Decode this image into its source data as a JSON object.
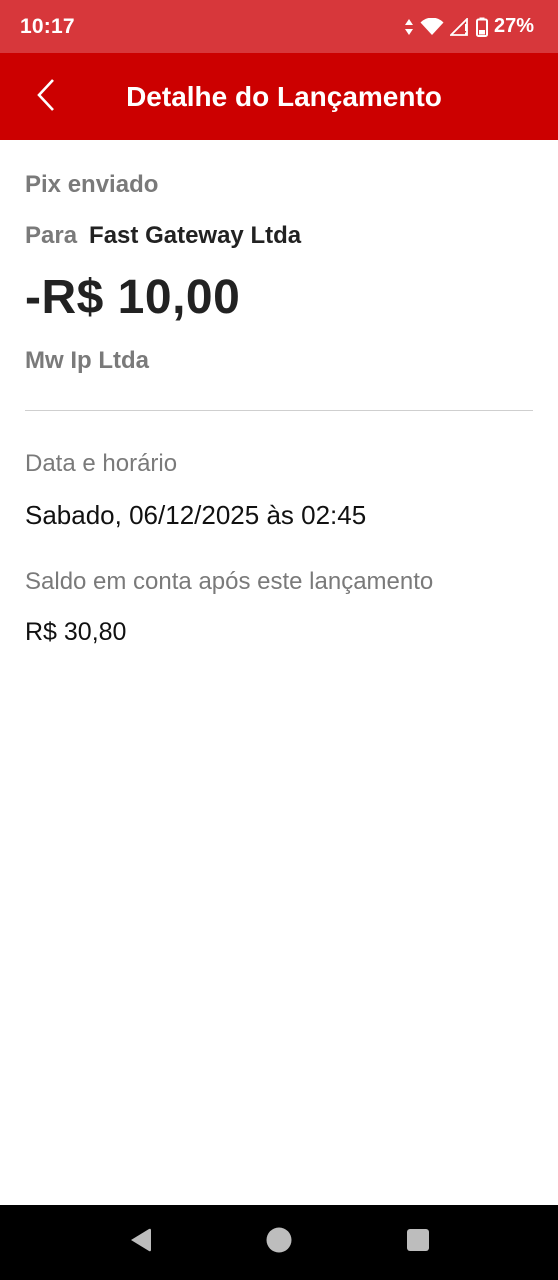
{
  "status_bar": {
    "time": "10:17",
    "battery_percent": "27%",
    "icons": [
      "data-arrows-icon",
      "wifi-icon",
      "signal-icon",
      "battery-icon"
    ]
  },
  "app_bar": {
    "title": "Detalhe do Lançamento",
    "back_icon": "chevron-left-icon",
    "background_color": "#cc0000"
  },
  "transaction": {
    "type": "Pix enviado",
    "recipient_prefix": "Para",
    "recipient_name": "Fast Gateway Ltda",
    "amount": "-R$ 10,00",
    "institution": "Mw Ip Ltda"
  },
  "details": {
    "date_label": "Data e horário",
    "date_value": "Sabado, 06/12/2025 às 02:45",
    "balance_label": "Saldo em conta após este lançamento",
    "balance_value": "R$ 30,80"
  },
  "nav_bar": {
    "buttons": [
      "back-triangle-icon",
      "home-circle-icon",
      "recents-square-icon"
    ]
  }
}
